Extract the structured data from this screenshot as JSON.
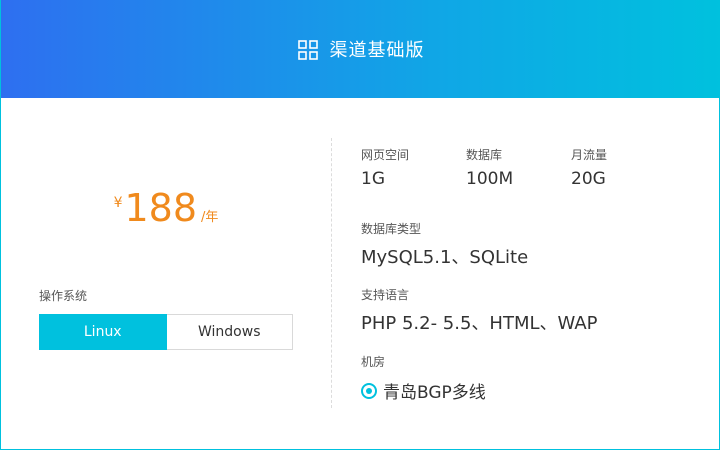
{
  "header": {
    "title": "渠道基础版",
    "icon": "grid-icon"
  },
  "pricing": {
    "currency": "¥",
    "amount": "188",
    "unit": "/年"
  },
  "os": {
    "label": "操作系统",
    "options": [
      {
        "label": "Linux",
        "selected": true
      },
      {
        "label": "Windows",
        "selected": false
      }
    ]
  },
  "specs": {
    "web_space": {
      "label": "网页空间",
      "value": "1G"
    },
    "database": {
      "label": "数据库",
      "value": "100M"
    },
    "monthly_traffic": {
      "label": "月流量",
      "value": "20G"
    },
    "db_type": {
      "label": "数据库类型",
      "value": "MySQL5.1、SQLite"
    },
    "languages": {
      "label": "支持语言",
      "value": "PHP 5.2- 5.5、HTML、WAP"
    },
    "datacenter": {
      "label": "机房",
      "option": "青岛BGP多线"
    }
  },
  "colors": {
    "accent": "#00c1de",
    "price": "#f08a1d",
    "header_start": "#2e6ff0"
  }
}
